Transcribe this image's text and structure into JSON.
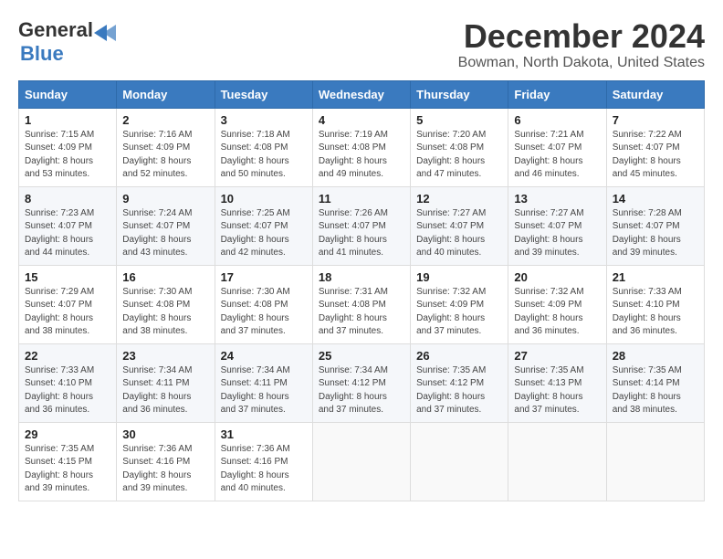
{
  "header": {
    "logo_general": "General",
    "logo_blue": "Blue",
    "month_title": "December 2024",
    "location": "Bowman, North Dakota, United States"
  },
  "weekdays": [
    "Sunday",
    "Monday",
    "Tuesday",
    "Wednesday",
    "Thursday",
    "Friday",
    "Saturday"
  ],
  "weeks": [
    [
      {
        "day": "1",
        "sunrise": "Sunrise: 7:15 AM",
        "sunset": "Sunset: 4:09 PM",
        "daylight": "Daylight: 8 hours and 53 minutes."
      },
      {
        "day": "2",
        "sunrise": "Sunrise: 7:16 AM",
        "sunset": "Sunset: 4:09 PM",
        "daylight": "Daylight: 8 hours and 52 minutes."
      },
      {
        "day": "3",
        "sunrise": "Sunrise: 7:18 AM",
        "sunset": "Sunset: 4:08 PM",
        "daylight": "Daylight: 8 hours and 50 minutes."
      },
      {
        "day": "4",
        "sunrise": "Sunrise: 7:19 AM",
        "sunset": "Sunset: 4:08 PM",
        "daylight": "Daylight: 8 hours and 49 minutes."
      },
      {
        "day": "5",
        "sunrise": "Sunrise: 7:20 AM",
        "sunset": "Sunset: 4:08 PM",
        "daylight": "Daylight: 8 hours and 47 minutes."
      },
      {
        "day": "6",
        "sunrise": "Sunrise: 7:21 AM",
        "sunset": "Sunset: 4:07 PM",
        "daylight": "Daylight: 8 hours and 46 minutes."
      },
      {
        "day": "7",
        "sunrise": "Sunrise: 7:22 AM",
        "sunset": "Sunset: 4:07 PM",
        "daylight": "Daylight: 8 hours and 45 minutes."
      }
    ],
    [
      {
        "day": "8",
        "sunrise": "Sunrise: 7:23 AM",
        "sunset": "Sunset: 4:07 PM",
        "daylight": "Daylight: 8 hours and 44 minutes."
      },
      {
        "day": "9",
        "sunrise": "Sunrise: 7:24 AM",
        "sunset": "Sunset: 4:07 PM",
        "daylight": "Daylight: 8 hours and 43 minutes."
      },
      {
        "day": "10",
        "sunrise": "Sunrise: 7:25 AM",
        "sunset": "Sunset: 4:07 PM",
        "daylight": "Daylight: 8 hours and 42 minutes."
      },
      {
        "day": "11",
        "sunrise": "Sunrise: 7:26 AM",
        "sunset": "Sunset: 4:07 PM",
        "daylight": "Daylight: 8 hours and 41 minutes."
      },
      {
        "day": "12",
        "sunrise": "Sunrise: 7:27 AM",
        "sunset": "Sunset: 4:07 PM",
        "daylight": "Daylight: 8 hours and 40 minutes."
      },
      {
        "day": "13",
        "sunrise": "Sunrise: 7:27 AM",
        "sunset": "Sunset: 4:07 PM",
        "daylight": "Daylight: 8 hours and 39 minutes."
      },
      {
        "day": "14",
        "sunrise": "Sunrise: 7:28 AM",
        "sunset": "Sunset: 4:07 PM",
        "daylight": "Daylight: 8 hours and 39 minutes."
      }
    ],
    [
      {
        "day": "15",
        "sunrise": "Sunrise: 7:29 AM",
        "sunset": "Sunset: 4:07 PM",
        "daylight": "Daylight: 8 hours and 38 minutes."
      },
      {
        "day": "16",
        "sunrise": "Sunrise: 7:30 AM",
        "sunset": "Sunset: 4:08 PM",
        "daylight": "Daylight: 8 hours and 38 minutes."
      },
      {
        "day": "17",
        "sunrise": "Sunrise: 7:30 AM",
        "sunset": "Sunset: 4:08 PM",
        "daylight": "Daylight: 8 hours and 37 minutes."
      },
      {
        "day": "18",
        "sunrise": "Sunrise: 7:31 AM",
        "sunset": "Sunset: 4:08 PM",
        "daylight": "Daylight: 8 hours and 37 minutes."
      },
      {
        "day": "19",
        "sunrise": "Sunrise: 7:32 AM",
        "sunset": "Sunset: 4:09 PM",
        "daylight": "Daylight: 8 hours and 37 minutes."
      },
      {
        "day": "20",
        "sunrise": "Sunrise: 7:32 AM",
        "sunset": "Sunset: 4:09 PM",
        "daylight": "Daylight: 8 hours and 36 minutes."
      },
      {
        "day": "21",
        "sunrise": "Sunrise: 7:33 AM",
        "sunset": "Sunset: 4:10 PM",
        "daylight": "Daylight: 8 hours and 36 minutes."
      }
    ],
    [
      {
        "day": "22",
        "sunrise": "Sunrise: 7:33 AM",
        "sunset": "Sunset: 4:10 PM",
        "daylight": "Daylight: 8 hours and 36 minutes."
      },
      {
        "day": "23",
        "sunrise": "Sunrise: 7:34 AM",
        "sunset": "Sunset: 4:11 PM",
        "daylight": "Daylight: 8 hours and 36 minutes."
      },
      {
        "day": "24",
        "sunrise": "Sunrise: 7:34 AM",
        "sunset": "Sunset: 4:11 PM",
        "daylight": "Daylight: 8 hours and 37 minutes."
      },
      {
        "day": "25",
        "sunrise": "Sunrise: 7:34 AM",
        "sunset": "Sunset: 4:12 PM",
        "daylight": "Daylight: 8 hours and 37 minutes."
      },
      {
        "day": "26",
        "sunrise": "Sunrise: 7:35 AM",
        "sunset": "Sunset: 4:12 PM",
        "daylight": "Daylight: 8 hours and 37 minutes."
      },
      {
        "day": "27",
        "sunrise": "Sunrise: 7:35 AM",
        "sunset": "Sunset: 4:13 PM",
        "daylight": "Daylight: 8 hours and 37 minutes."
      },
      {
        "day": "28",
        "sunrise": "Sunrise: 7:35 AM",
        "sunset": "Sunset: 4:14 PM",
        "daylight": "Daylight: 8 hours and 38 minutes."
      }
    ],
    [
      {
        "day": "29",
        "sunrise": "Sunrise: 7:35 AM",
        "sunset": "Sunset: 4:15 PM",
        "daylight": "Daylight: 8 hours and 39 minutes."
      },
      {
        "day": "30",
        "sunrise": "Sunrise: 7:36 AM",
        "sunset": "Sunset: 4:16 PM",
        "daylight": "Daylight: 8 hours and 39 minutes."
      },
      {
        "day": "31",
        "sunrise": "Sunrise: 7:36 AM",
        "sunset": "Sunset: 4:16 PM",
        "daylight": "Daylight: 8 hours and 40 minutes."
      },
      null,
      null,
      null,
      null
    ]
  ]
}
